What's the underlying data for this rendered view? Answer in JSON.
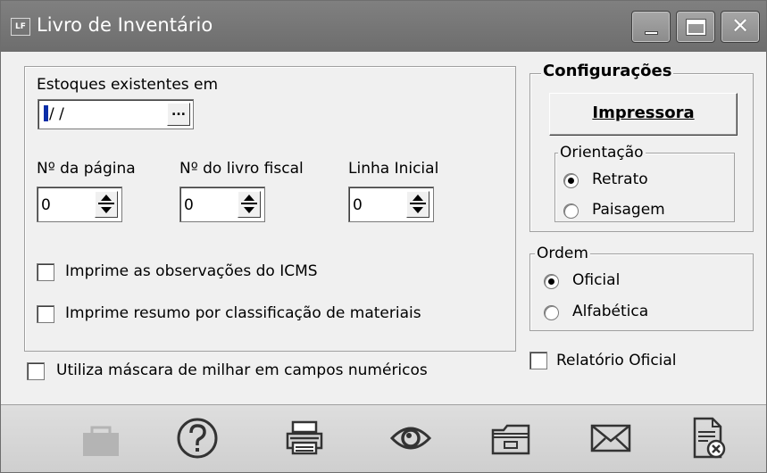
{
  "window": {
    "app_badge": "LF",
    "title": "Livro de Inventário",
    "controls": {
      "minimize_icon": "minimize-icon",
      "maximize_icon": "maximize-icon",
      "close_icon": "close-icon"
    }
  },
  "main": {
    "stock_label": "Estoques existentes em",
    "stock_date_value": "/ /",
    "date_picker_label": "...",
    "page_no_label": "Nº da página",
    "page_no_value": "0",
    "book_no_label": "Nº do livro fiscal",
    "book_no_value": "0",
    "initial_line_label": "Linha Inicial",
    "initial_line_value": "0",
    "print_icms_obs_label": "Imprime as observações do ICMS",
    "print_summary_label": "Imprime resumo por classificação de materiais"
  },
  "thousand_mask_label": "Utiliza máscara de milhar em campos numéricos",
  "config": {
    "title": "Configurações",
    "printer_button_label": "Impressora",
    "orientation": {
      "title": "Orientação",
      "options": [
        "Retrato",
        "Paisagem"
      ],
      "selected": "Retrato"
    }
  },
  "order": {
    "title": "Ordem",
    "options": [
      "Oficial",
      "Alfabética"
    ],
    "selected": "Oficial"
  },
  "official_report_label": "Relatório Oficial",
  "toolbar": {
    "icons": [
      "briefcase-icon",
      "help-icon",
      "printer-icon",
      "preview-icon",
      "folder-icon",
      "mail-icon",
      "close-document-icon"
    ]
  },
  "colors": {
    "titlebar": "#6d6d6d",
    "window_bg": "#f0f0f0",
    "toolbar_bg": "#d6d6d6"
  }
}
